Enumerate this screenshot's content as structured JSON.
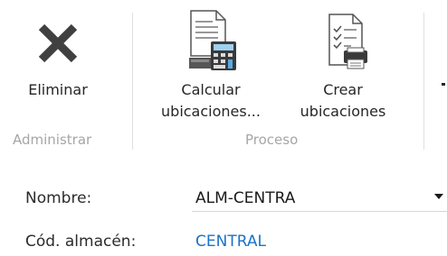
{
  "ribbon": {
    "groups": [
      {
        "label": "Administrar"
      },
      {
        "label": "Proceso"
      }
    ],
    "buttons": [
      {
        "label": "Eliminar",
        "icon": "delete-x-icon"
      },
      {
        "label_line1": "Calcular",
        "label_line2": "ubicaciones...",
        "icon": "calculator-document-icon"
      },
      {
        "label_line1": "Crear",
        "label_line2": "ubicaciones",
        "icon": "checklist-document-icon"
      }
    ]
  },
  "fields": {
    "nombre": {
      "label": "Nombre:",
      "value": "ALM-CENTRA"
    },
    "cod_almacen": {
      "label": "Cód. almacén:",
      "value": "CENTRAL"
    }
  },
  "colors": {
    "link": "#1a73c8",
    "group_label": "#a6a6a6",
    "icon_dark": "#404040"
  }
}
